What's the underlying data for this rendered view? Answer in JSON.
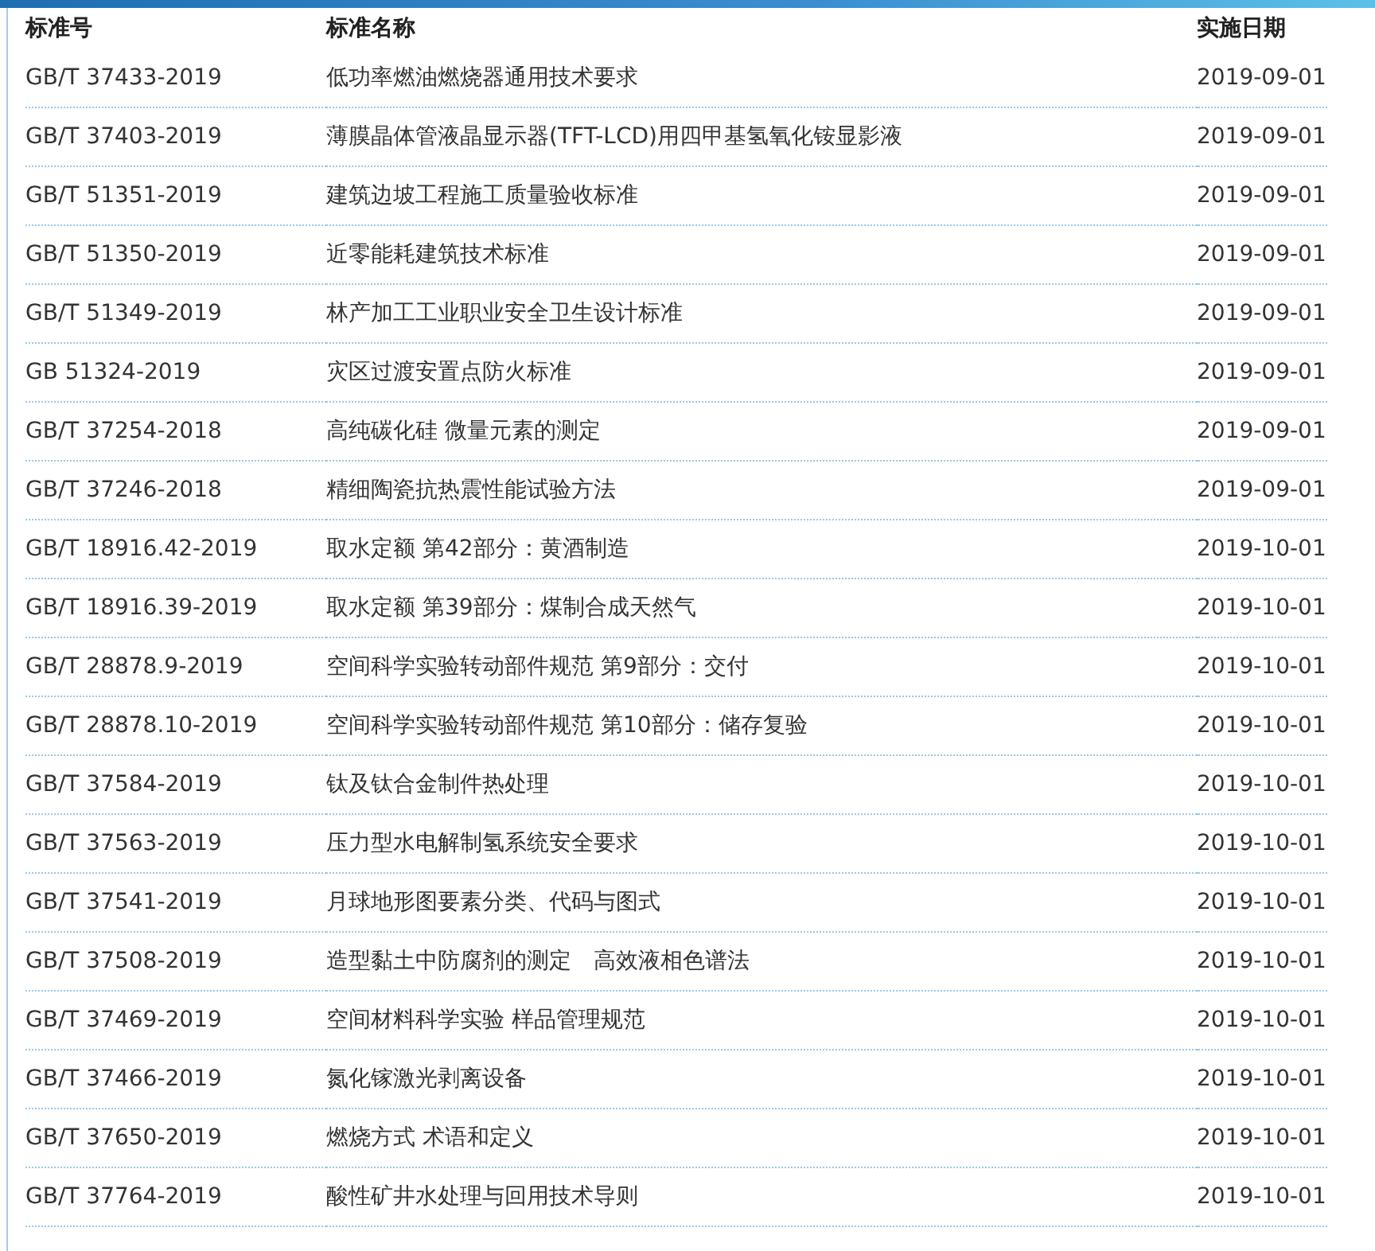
{
  "table": {
    "columns": [
      "标准号",
      "标准名称",
      "实施日期"
    ],
    "rows": [
      {
        "code": "GB/T 37433-2019",
        "name": "低功率燃油燃烧器通用技术要求",
        "date": "2019-09-01"
      },
      {
        "code": "GB/T 37403-2019",
        "name": "薄膜晶体管液晶显示器(TFT-LCD)用四甲基氢氧化铵显影液",
        "date": "2019-09-01"
      },
      {
        "code": "GB/T 51351-2019",
        "name": "建筑边坡工程施工质量验收标准",
        "date": "2019-09-01"
      },
      {
        "code": "GB/T 51350-2019",
        "name": "近零能耗建筑技术标准",
        "date": "2019-09-01"
      },
      {
        "code": "GB/T 51349-2019",
        "name": "林产加工工业职业安全卫生设计标准",
        "date": "2019-09-01"
      },
      {
        "code": "GB 51324-2019",
        "name": "灾区过渡安置点防火标准",
        "date": "2019-09-01"
      },
      {
        "code": "GB/T 37254-2018",
        "name": "高纯碳化硅 微量元素的测定",
        "date": "2019-09-01"
      },
      {
        "code": "GB/T 37246-2018",
        "name": "精细陶瓷抗热震性能试验方法",
        "date": "2019-09-01"
      },
      {
        "code": "GB/T 18916.42-2019",
        "name": "取水定额 第42部分：黄酒制造",
        "date": "2019-10-01"
      },
      {
        "code": "GB/T 18916.39-2019",
        "name": "取水定额 第39部分：煤制合成天然气",
        "date": "2019-10-01"
      },
      {
        "code": "GB/T 28878.9-2019",
        "name": "空间科学实验转动部件规范 第9部分：交付",
        "date": "2019-10-01"
      },
      {
        "code": "GB/T 28878.10-2019",
        "name": "空间科学实验转动部件规范 第10部分：储存复验",
        "date": "2019-10-01"
      },
      {
        "code": "GB/T 37584-2019",
        "name": "钛及钛合金制件热处理",
        "date": "2019-10-01"
      },
      {
        "code": "GB/T 37563-2019",
        "name": "压力型水电解制氢系统安全要求",
        "date": "2019-10-01"
      },
      {
        "code": "GB/T 37541-2019",
        "name": "月球地形图要素分类、代码与图式",
        "date": "2019-10-01"
      },
      {
        "code": "GB/T 37508-2019",
        "name": "造型黏土中防腐剂的测定　高效液相色谱法",
        "date": "2019-10-01"
      },
      {
        "code": "GB/T 37469-2019",
        "name": "空间材料科学实验 样品管理规范",
        "date": "2019-10-01"
      },
      {
        "code": "GB/T 37466-2019",
        "name": "氮化镓激光剥离设备",
        "date": "2019-10-01"
      },
      {
        "code": "GB/T 37650-2019",
        "name": "燃烧方式 术语和定义",
        "date": "2019-10-01"
      },
      {
        "code": "GB/T 37764-2019",
        "name": "酸性矿井水处理与回用技术导则",
        "date": "2019-10-01"
      }
    ]
  }
}
